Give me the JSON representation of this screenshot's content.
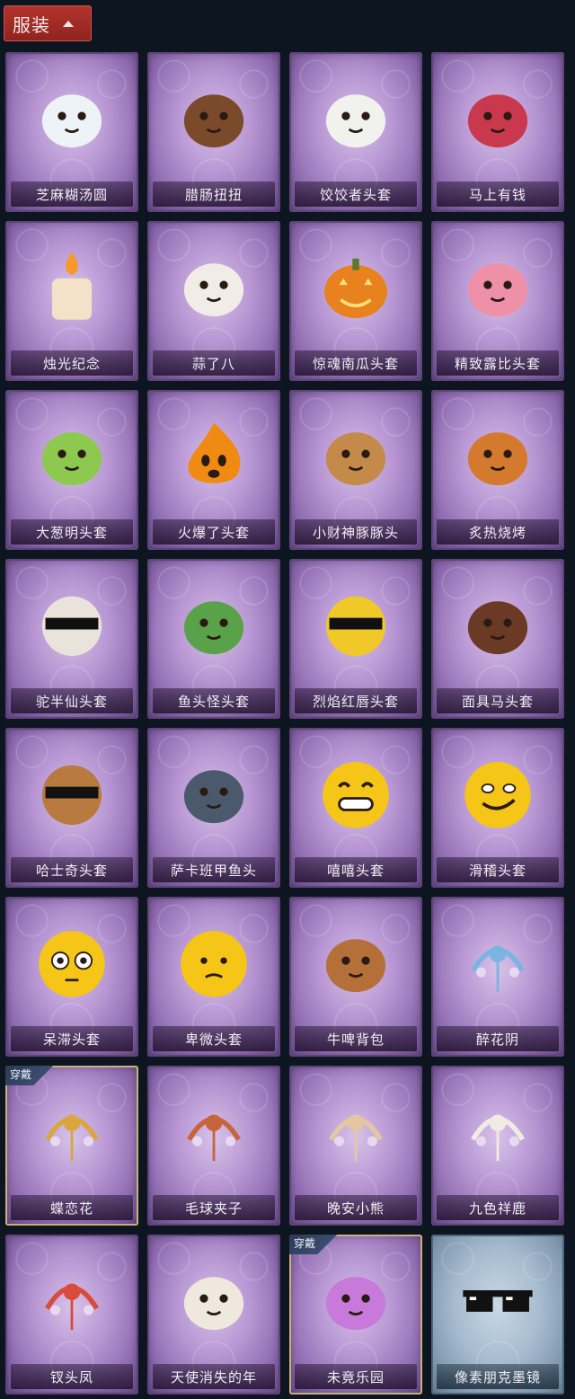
{
  "header": {
    "label": "服装"
  },
  "badge_label": "穿戴",
  "items": [
    {
      "label": "芝麻糊汤圆",
      "icon": "rice-ball-icon",
      "color": "#eef3f8",
      "bg": "purple"
    },
    {
      "label": "腊肠扭扭",
      "icon": "dog-head-icon",
      "color": "#7a4a2a",
      "bg": "purple"
    },
    {
      "label": "饺饺者头套",
      "icon": "dumpling-icon",
      "color": "#f1f1ee",
      "bg": "purple"
    },
    {
      "label": "马上有钱",
      "icon": "horse-plush-icon",
      "color": "#c9384d",
      "bg": "purple"
    },
    {
      "label": "烛光纪念",
      "icon": "candle-icon",
      "color": "#f3e2c7",
      "bg": "purple"
    },
    {
      "label": "蒜了八",
      "icon": "garlic-icon",
      "color": "#f1ede6",
      "bg": "purple"
    },
    {
      "label": "惊魂南瓜头套",
      "icon": "pumpkin-icon",
      "color": "#e8821e",
      "bg": "purple"
    },
    {
      "label": "精致露比头套",
      "icon": "pink-beaver-icon",
      "color": "#ee90a7",
      "bg": "purple"
    },
    {
      "label": "大葱明头套",
      "icon": "scallion-icon",
      "color": "#8ec94f",
      "bg": "purple"
    },
    {
      "label": "火爆了头套",
      "icon": "fireball-icon",
      "color": "#f08a12",
      "bg": "purple"
    },
    {
      "label": "小财神豚豚头",
      "icon": "capybara-icon",
      "color": "#c48a4a",
      "bg": "purple"
    },
    {
      "label": "炙热烧烤",
      "icon": "meat-bone-icon",
      "color": "#d47a2f",
      "bg": "purple"
    },
    {
      "label": "驼半仙头套",
      "icon": "bear-sunglasses-icon",
      "color": "#e9e3dc",
      "bg": "purple"
    },
    {
      "label": "鱼头怪头套",
      "icon": "fish-head-icon",
      "color": "#5aa24a",
      "bg": "purple"
    },
    {
      "label": "烈焰红唇头套",
      "icon": "pikachu-hood-icon",
      "color": "#f0c928",
      "bg": "purple"
    },
    {
      "label": "面具马头套",
      "icon": "horse-mask-icon",
      "color": "#6b3a25",
      "bg": "purple"
    },
    {
      "label": "哈士奇头套",
      "icon": "husky-icon",
      "color": "#b87a3e",
      "bg": "purple"
    },
    {
      "label": "萨卡班甲鱼头",
      "icon": "fish-plush-icon",
      "color": "#4a5a6c",
      "bg": "purple"
    },
    {
      "label": "嘻嘻头套",
      "icon": "grin-emoji-icon",
      "color": "#f5c518",
      "bg": "purple"
    },
    {
      "label": "滑稽头套",
      "icon": "smirk-emoji-icon",
      "color": "#f5c518",
      "bg": "purple"
    },
    {
      "label": "呆滞头套",
      "icon": "stare-emoji-icon",
      "color": "#f5c518",
      "bg": "purple"
    },
    {
      "label": "卑微头套",
      "icon": "shy-emoji-icon",
      "color": "#f5c518",
      "bg": "purple"
    },
    {
      "label": "牛啤背包",
      "icon": "beer-cow-backpack-icon",
      "color": "#b5703a",
      "bg": "purple"
    },
    {
      "label": "醉花阴",
      "icon": "flower-headdress-icon",
      "color": "#7ab4e0",
      "bg": "purple"
    },
    {
      "label": "蝶恋花",
      "icon": "butterfly-headdress-icon",
      "color": "#d9a640",
      "bg": "purple",
      "worn": true
    },
    {
      "label": "毛球夹子",
      "icon": "red-panda-clip-icon",
      "color": "#c8643a",
      "bg": "purple"
    },
    {
      "label": "晚安小熊",
      "icon": "bear-pendant-icon",
      "color": "#e6c6a0",
      "bg": "purple"
    },
    {
      "label": "九色祥鹿",
      "icon": "deer-pendant-icon",
      "color": "#f0ece4",
      "bg": "purple"
    },
    {
      "label": "钗头凤",
      "icon": "phoenix-crown-icon",
      "color": "#d94b3a",
      "bg": "purple"
    },
    {
      "label": "天使消失的年",
      "icon": "angel-doll-icon",
      "color": "#efe8dc",
      "bg": "purple"
    },
    {
      "label": "未竟乐园",
      "icon": "pink-doll-icon",
      "color": "#c77ad9",
      "bg": "purple",
      "worn": true
    },
    {
      "label": "像素朋克墨镜",
      "icon": "pixel-sunglasses-icon",
      "color": "#111111",
      "bg": "blue"
    }
  ]
}
